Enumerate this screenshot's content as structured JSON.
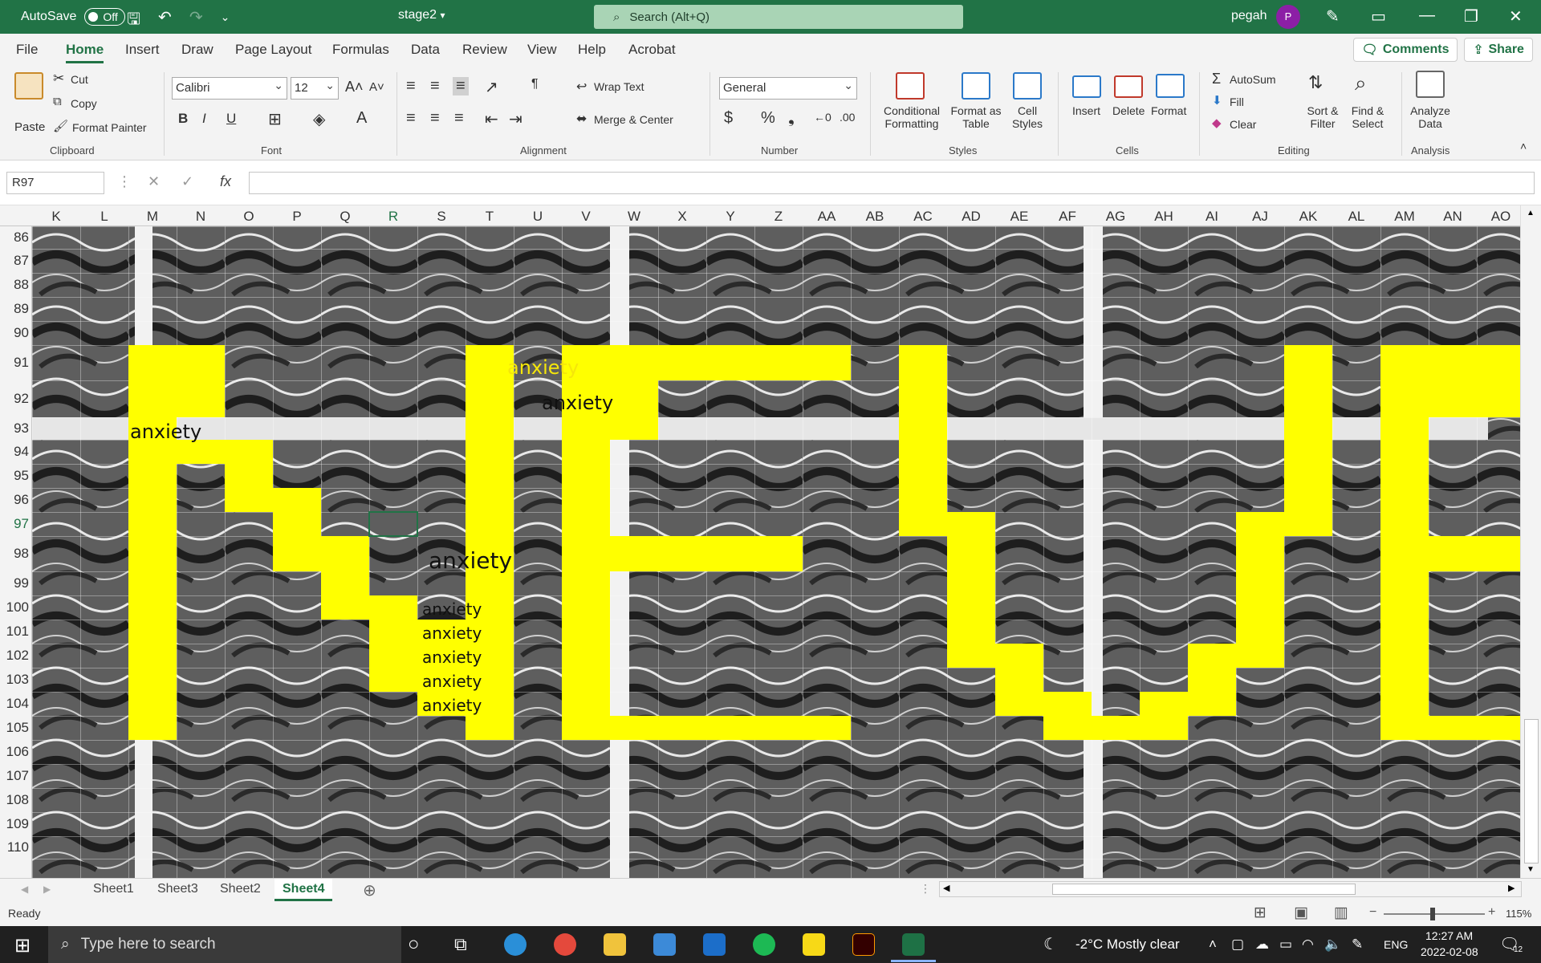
{
  "titlebar": {
    "autosave_label": "AutoSave",
    "autosave_state": "Off",
    "doc_name": "stage2",
    "search_placeholder": "Search (Alt+Q)",
    "user_name": "pegah",
    "avatar_initial": "P"
  },
  "menu": {
    "tabs": [
      "File",
      "Home",
      "Insert",
      "Draw",
      "Page Layout",
      "Formulas",
      "Data",
      "Review",
      "View",
      "Help",
      "Acrobat"
    ],
    "active_tab": "Home",
    "comments_label": "Comments",
    "share_label": "Share"
  },
  "ribbon": {
    "clipboard": {
      "paste": "Paste",
      "cut": "Cut",
      "copy": "Copy",
      "format_painter": "Format Painter",
      "group_label": "Clipboard"
    },
    "font": {
      "font_name": "Calibri",
      "font_size": "12",
      "group_label": "Font"
    },
    "alignment": {
      "wrap_text": "Wrap Text",
      "merge_center": "Merge & Center",
      "group_label": "Alignment"
    },
    "number": {
      "format": "General",
      "group_label": "Number"
    },
    "styles": {
      "conditional": [
        "Conditional",
        "Formatting"
      ],
      "format_table": [
        "Format as",
        "Table"
      ],
      "cell_styles": [
        "Cell",
        "Styles"
      ],
      "group_label": "Styles"
    },
    "cells": {
      "insert": "Insert",
      "delete": "Delete",
      "format": "Format",
      "group_label": "Cells"
    },
    "editing": {
      "autosum": "AutoSum",
      "fill": "Fill",
      "clear": "Clear",
      "sort_filter": [
        "Sort &",
        "Filter"
      ],
      "find_select": [
        "Find &",
        "Select"
      ],
      "group_label": "Editing"
    },
    "analysis": {
      "analyze": [
        "Analyze",
        "Data"
      ],
      "group_label": "Analysis"
    }
  },
  "formula_bar": {
    "name_box": "R97",
    "fx": "fx",
    "content": ""
  },
  "grid": {
    "columns": [
      "K",
      "L",
      "M",
      "N",
      "O",
      "P",
      "Q",
      "R",
      "S",
      "T",
      "U",
      "V",
      "W",
      "X",
      "Y",
      "Z",
      "AA",
      "AB",
      "AC",
      "AD",
      "AE",
      "AF",
      "AG",
      "AH",
      "AI",
      "AJ",
      "AK",
      "AL",
      "AM",
      "AN",
      "AO"
    ],
    "selected_column": "R",
    "rows": [
      "86",
      "87",
      "88",
      "89",
      "90",
      "91",
      "92",
      "93",
      "94",
      "95",
      "96",
      "97",
      "98",
      "99",
      "100",
      "101",
      "102",
      "103",
      "104",
      "105",
      "106",
      "107",
      "108",
      "109",
      "110"
    ],
    "selected_row": "97",
    "selected_cell": "R97",
    "overlay_word": "anxiety",
    "highlight_color": "#ffff00"
  },
  "sheets": {
    "tabs": [
      "Sheet1",
      "Sheet3",
      "Sheet2",
      "Sheet4"
    ],
    "active": "Sheet4"
  },
  "status": {
    "ready": "Ready",
    "zoom": "115%"
  },
  "taskbar": {
    "search_placeholder": "Type here to search",
    "weather": "-2°C  Mostly clear",
    "language": "ENG",
    "time": "12:27 AM",
    "date": "2022-02-08",
    "notification_count": "12"
  }
}
